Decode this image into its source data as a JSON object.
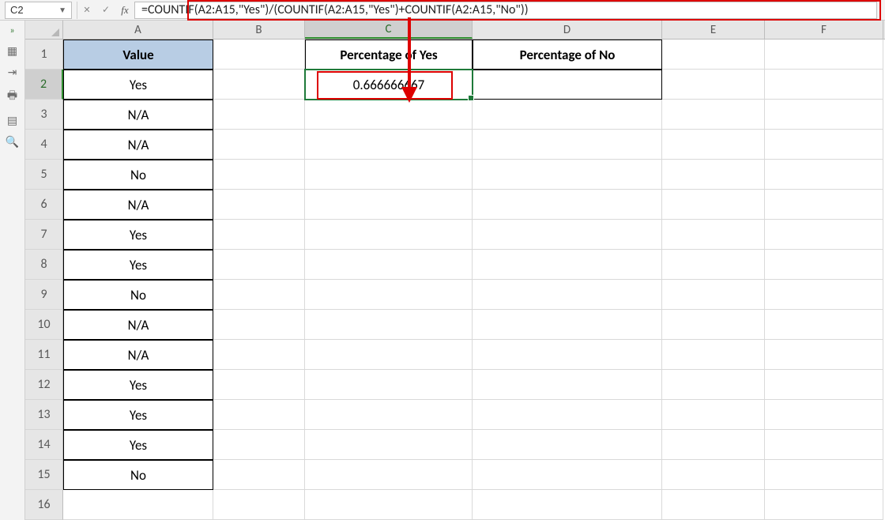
{
  "namebox": "C2",
  "formula": "=COUNTIF(A2:A15,\"Yes\")/(COUNTIF(A2:A15,\"Yes\")+COUNTIF(A2:A15,\"No\"))",
  "columns": [
    "A",
    "B",
    "C",
    "D",
    "E",
    "F"
  ],
  "activeCol": "C",
  "activeRow": 2,
  "headers": {
    "A1": "Value",
    "C1": "Percentage of Yes",
    "D1": "Percentage of No"
  },
  "colA": [
    "Yes",
    "N/A",
    "N/A",
    "No",
    "N/A",
    "Yes",
    "Yes",
    "No",
    "N/A",
    "N/A",
    "Yes",
    "Yes",
    "Yes",
    "No"
  ],
  "C2": "0.666666667",
  "rows": [
    "1",
    "2",
    "3",
    "4",
    "5",
    "6",
    "7",
    "8",
    "9",
    "10",
    "11",
    "12",
    "13",
    "14",
    "15",
    "16"
  ],
  "sidebar_icons": [
    "»",
    "▦",
    "⇥",
    "🖶",
    "▤",
    "🔍"
  ]
}
